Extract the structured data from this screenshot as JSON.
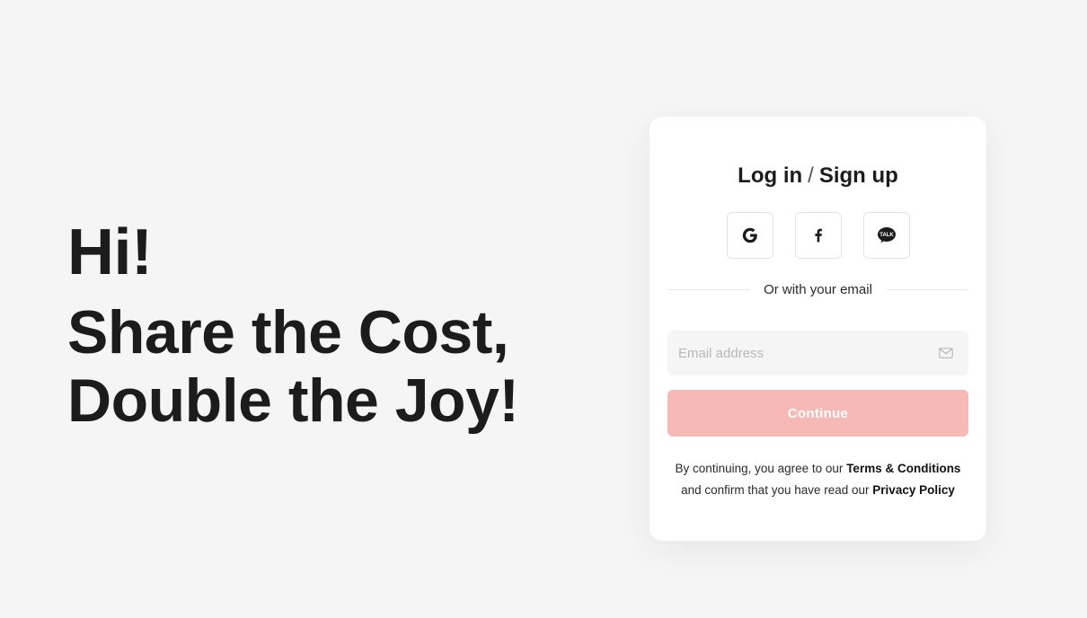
{
  "hero": {
    "greeting": "Hi!",
    "slogan_line1": "Share the Cost,",
    "slogan_line2": "Double the Joy!"
  },
  "auth_card": {
    "title_login": "Log in",
    "title_separator": "/",
    "title_signup": "Sign up",
    "social_buttons": [
      {
        "name": "google",
        "icon": "google-icon"
      },
      {
        "name": "facebook",
        "icon": "facebook-icon"
      },
      {
        "name": "kakaotalk",
        "icon": "kakaotalk-icon",
        "icon_text": "TALK"
      }
    ],
    "divider_text": "Or with your email",
    "email": {
      "placeholder": "Email address",
      "value": "",
      "icon": "mail-icon"
    },
    "continue_label": "Continue",
    "legal": {
      "prefix": "By continuing, you agree to our",
      "terms_link": "Terms & Conditions",
      "middle": "and confirm that you have read our",
      "privacy_link": "Privacy Policy"
    }
  },
  "colors": {
    "background": "#f5f5f5",
    "card": "#ffffff",
    "primary_disabled": "#f7b9b6",
    "text": "#1c1c1c"
  }
}
